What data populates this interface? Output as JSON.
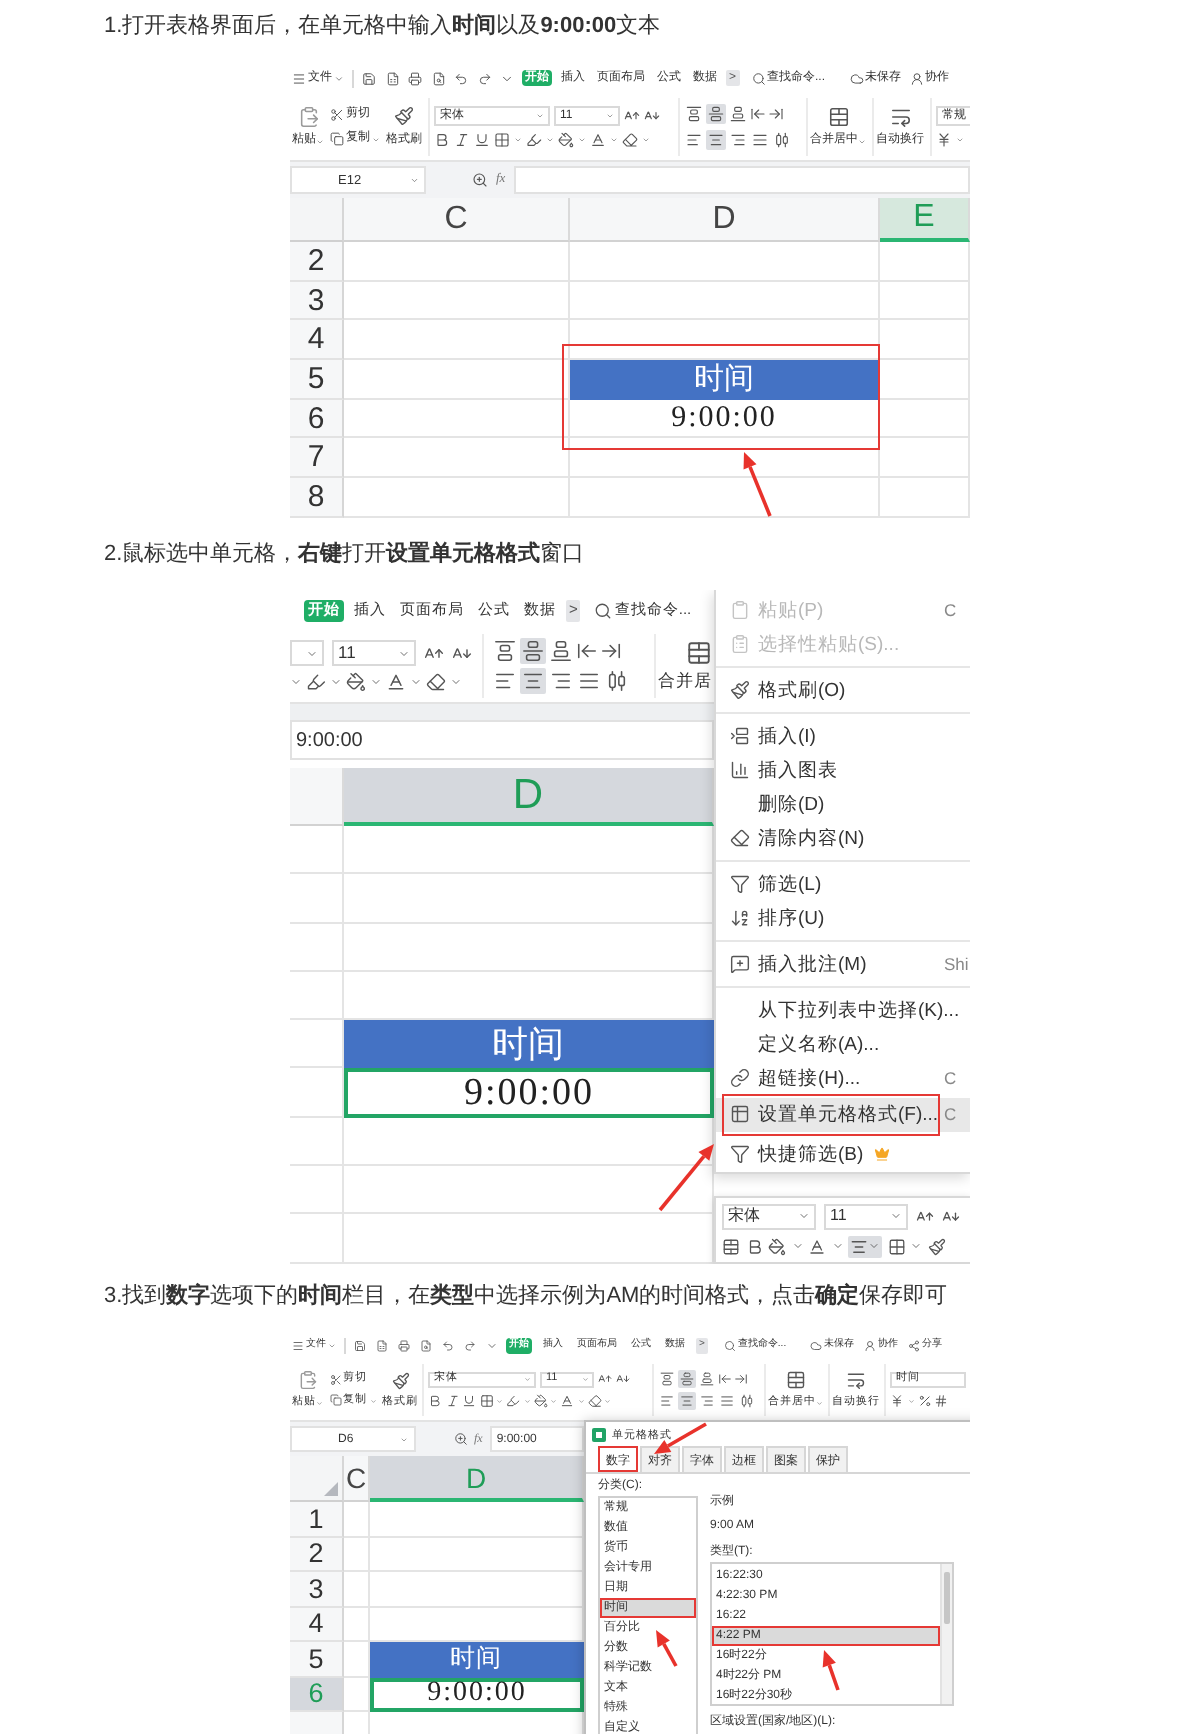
{
  "steps": [
    {
      "instruction": "1.打开表格界面后，在单元格中输入**时间**以及**9:00:00**文本",
      "screenshot": {
        "kind": "sheet",
        "menu_bar": {
          "file": "文件",
          "tabs": [
            {
              "label": "开始",
              "selected": true
            },
            {
              "label": "插入",
              "selected": false
            },
            {
              "label": "页面布局",
              "selected": false
            },
            {
              "label": "公式",
              "selected": false
            },
            {
              "label": "数据",
              "selected": false
            }
          ],
          "more": ">",
          "search": "查找命令...",
          "actions": [
            "未保存",
            "协作"
          ]
        },
        "ribbon": {
          "paste": "粘贴",
          "cut": "剪切",
          "copy": "复制",
          "format_painter": "格式刷",
          "font": "宋体",
          "font_size": "11",
          "vertical_align": [
            {
              "selected": false
            },
            {
              "selected": true
            },
            {
              "selected": false
            }
          ],
          "horizontal_align": [
            {
              "selected": false
            },
            {
              "selected": true
            },
            {
              "selected": false
            },
            {
              "selected": false
            },
            {
              "selected": false
            }
          ],
          "merge": "合并居中",
          "wrap": "自动换行",
          "number_format": "常规"
        },
        "formula_bar": {
          "cell_ref": "E12",
          "fx": "fx"
        },
        "grid": {
          "columns": [
            {
              "label": "C",
              "selected": false
            },
            {
              "label": "D",
              "selected": false
            },
            {
              "label": "E",
              "selected": true
            }
          ],
          "rows": [
            {
              "label": "2",
              "selected": false,
              "cells": [
                {
                  "kind": "empty"
                },
                {
                  "kind": "empty"
                },
                {
                  "kind": "empty"
                }
              ]
            },
            {
              "label": "3",
              "selected": false,
              "cells": [
                {
                  "kind": "empty"
                },
                {
                  "kind": "empty"
                },
                {
                  "kind": "empty"
                }
              ]
            },
            {
              "label": "4",
              "selected": false,
              "cells": [
                {
                  "kind": "empty"
                },
                {
                  "kind": "empty"
                },
                {
                  "kind": "empty"
                }
              ]
            },
            {
              "label": "5",
              "selected": false,
              "cells": [
                {
                  "kind": "empty"
                },
                {
                  "kind": "heading",
                  "text": "时间"
                },
                {
                  "kind": "empty"
                }
              ]
            },
            {
              "label": "6",
              "selected": false,
              "cells": [
                {
                  "kind": "empty"
                },
                {
                  "kind": "value",
                  "text": "9:00:00",
                  "selected": false
                },
                {
                  "kind": "empty"
                }
              ]
            },
            {
              "label": "7",
              "selected": false,
              "cells": [
                {
                  "kind": "empty"
                },
                {
                  "kind": "empty"
                },
                {
                  "kind": "empty"
                }
              ]
            },
            {
              "label": "8",
              "selected": false,
              "cells": [
                {
                  "kind": "empty"
                },
                {
                  "kind": "empty"
                },
                {
                  "kind": "empty"
                }
              ]
            }
          ]
        }
      }
    },
    {
      "instruction": "2.鼠标选中单元格，**右键**打开**设置单元格格式**窗口",
      "screenshot": {
        "kind": "context-menu",
        "menu_bar": {
          "tabs": [
            {
              "label": "开始",
              "selected": true
            },
            {
              "label": "插入",
              "selected": false
            },
            {
              "label": "页面布局",
              "selected": false
            },
            {
              "label": "公式",
              "selected": false
            },
            {
              "label": "数据",
              "selected": false
            }
          ],
          "more": ">",
          "search": "查找命令..."
        },
        "ribbon": {
          "font_size": "11",
          "vertical_align": [
            {
              "selected": false
            },
            {
              "selected": true
            },
            {
              "selected": false
            }
          ],
          "horizontal_align": [
            {
              "selected": false
            },
            {
              "selected": true
            },
            {
              "selected": false
            },
            {
              "selected": false
            },
            {
              "selected": false
            }
          ],
          "merge": "合并居"
        },
        "formula_bar": {
          "value": "9:00:00"
        },
        "grid": {
          "columns": [
            {
              "selected": false
            },
            {
              "label": "D",
              "selected": true
            }
          ],
          "rows": [
            {
              "cells": [
                {
                  "kind": "empty"
                },
                {
                  "kind": "empty"
                }
              ]
            },
            {
              "cells": [
                {
                  "kind": "empty"
                },
                {
                  "kind": "empty"
                }
              ]
            },
            {
              "cells": [
                {
                  "kind": "empty"
                },
                {
                  "kind": "empty"
                }
              ]
            },
            {
              "cells": [
                {
                  "kind": "empty"
                },
                {
                  "kind": "empty"
                }
              ]
            },
            {
              "cells": [
                {
                  "kind": "empty"
                },
                {
                  "kind": "heading",
                  "text": "时间"
                }
              ]
            },
            {
              "cells": [
                {
                  "kind": "empty"
                },
                {
                  "kind": "value",
                  "text": "9:00:00",
                  "selected": true
                }
              ]
            },
            {
              "cells": [
                {
                  "kind": "empty"
                },
                {
                  "kind": "empty"
                }
              ]
            },
            {
              "cells": [
                {
                  "kind": "empty"
                },
                {
                  "kind": "empty"
                }
              ]
            },
            {
              "cells": [
                {
                  "kind": "empty"
                },
                {
                  "kind": "empty"
                }
              ]
            }
          ]
        },
        "context_menu": {
          "items": [
            {
              "kind": "item",
              "label": "粘贴(P)",
              "shortcut": "C",
              "disabled": true,
              "marked": false
            },
            {
              "kind": "item",
              "label": "选择性粘贴(S)...",
              "disabled": true,
              "marked": false
            },
            {
              "kind": "divider"
            },
            {
              "kind": "item",
              "label": "格式刷(O)",
              "disabled": false,
              "marked": false
            },
            {
              "kind": "divider"
            },
            {
              "kind": "item",
              "label": "插入(I)",
              "disabled": false,
              "marked": false
            },
            {
              "kind": "item",
              "label": "插入图表",
              "disabled": false,
              "marked": false
            },
            {
              "kind": "item",
              "label": "删除(D)",
              "disabled": false,
              "marked": false
            },
            {
              "kind": "item",
              "label": "清除内容(N)",
              "disabled": false,
              "marked": false
            },
            {
              "kind": "divider"
            },
            {
              "kind": "item",
              "label": "筛选(L)",
              "disabled": false,
              "marked": false
            },
            {
              "kind": "item",
              "label": "排序(U)",
              "disabled": false,
              "marked": false
            },
            {
              "kind": "divider"
            },
            {
              "kind": "item",
              "label": "插入批注(M)",
              "shortcut": "Shi",
              "disabled": false,
              "marked": false
            },
            {
              "kind": "divider"
            },
            {
              "kind": "item",
              "label": "从下拉列表中选择(K)...",
              "disabled": false,
              "marked": false
            },
            {
              "kind": "item",
              "label": "定义名称(A)...",
              "disabled": false,
              "marked": false
            },
            {
              "kind": "item",
              "label": "超链接(H)...",
              "shortcut": "C",
              "disabled": false,
              "marked": false
            },
            {
              "kind": "item",
              "label": "设置单元格格式(F)...",
              "shortcut": "C",
              "disabled": false,
              "marked": true
            },
            {
              "kind": "item",
              "label": "快捷筛选(B)",
              "disabled": false,
              "marked": false
            }
          ]
        },
        "mini_toolbar": {
          "font": "宋体",
          "font_size": "11",
          "align": {
            "selected": true
          }
        }
      }
    },
    {
      "instruction": "3.找到**数字**选项下的**时间**栏目，在**类型**中选择示例为AM的时间格式，点击**确定**保存即可",
      "screenshot": {
        "kind": "format-dialog",
        "menu_bar": {
          "file": "文件",
          "tabs": [
            {
              "label": "开始",
              "selected": true
            },
            {
              "label": "插入",
              "selected": false
            },
            {
              "label": "页面布局",
              "selected": false
            },
            {
              "label": "公式",
              "selected": false
            },
            {
              "label": "数据",
              "selected": false
            }
          ],
          "more": ">",
          "search": "查找命令...",
          "actions": [
            "未保存",
            "协作",
            "分享"
          ]
        },
        "ribbon": {
          "paste": "粘贴",
          "cut": "剪切",
          "copy": "复制",
          "format_painter": "格式刷",
          "font": "宋体",
          "font_size": "11",
          "vertical_align": [
            {
              "selected": false
            },
            {
              "selected": true
            },
            {
              "selected": false
            }
          ],
          "horizontal_align": [
            {
              "selected": false
            },
            {
              "selected": true
            },
            {
              "selected": false
            },
            {
              "selected": false
            },
            {
              "selected": false
            }
          ],
          "merge": "合并居中",
          "wrap": "自动换行",
          "number_format": "时间"
        },
        "formula_bar": {
          "cell_ref": "D6",
          "fx": "fx",
          "value": "9:00:00"
        },
        "grid": {
          "columns": [
            {
              "label": "C",
              "selected": false
            },
            {
              "label": "D",
              "selected": true
            }
          ],
          "rows": [
            {
              "label": "1",
              "selected": false,
              "cells": [
                {
                  "kind": "empty"
                },
                {
                  "kind": "empty"
                }
              ]
            },
            {
              "label": "2",
              "selected": false,
              "cells": [
                {
                  "kind": "empty"
                },
                {
                  "kind": "empty"
                }
              ]
            },
            {
              "label": "3",
              "selected": false,
              "cells": [
                {
                  "kind": "empty"
                },
                {
                  "kind": "empty"
                }
              ]
            },
            {
              "label": "4",
              "selected": false,
              "cells": [
                {
                  "kind": "empty"
                },
                {
                  "kind": "empty"
                }
              ]
            },
            {
              "label": "5",
              "selected": false,
              "cells": [
                {
                  "kind": "empty"
                },
                {
                  "kind": "heading",
                  "text": "时间"
                }
              ]
            },
            {
              "label": "6",
              "selected": true,
              "cells": [
                {
                  "kind": "empty"
                },
                {
                  "kind": "value",
                  "text": "9:00:00",
                  "selected": true
                }
              ]
            },
            {
              "selected": false,
              "cells": [
                {
                  "kind": "empty"
                },
                {
                  "kind": "empty"
                }
              ]
            }
          ]
        },
        "dialog": {
          "title": "单元格格式",
          "tabs": [
            {
              "label": "数字",
              "selected": true,
              "marked": true
            },
            {
              "label": "对齐",
              "selected": false,
              "marked": false
            },
            {
              "label": "字体",
              "selected": false,
              "marked": false
            },
            {
              "label": "边框",
              "selected": false,
              "marked": false
            },
            {
              "label": "图案",
              "selected": false,
              "marked": false
            },
            {
              "label": "保护",
              "selected": false,
              "marked": false
            }
          ],
          "category_label": "分类(C):",
          "categories": [
            {
              "label": "常规",
              "selected": false,
              "marked": false
            },
            {
              "label": "数值",
              "selected": false,
              "marked": false
            },
            {
              "label": "货币",
              "selected": false,
              "marked": false
            },
            {
              "label": "会计专用",
              "selected": false,
              "marked": false
            },
            {
              "label": "日期",
              "selected": false,
              "marked": false
            },
            {
              "label": "时间",
              "selected": true,
              "marked": true
            },
            {
              "label": "百分比",
              "selected": false,
              "marked": false
            },
            {
              "label": "分数",
              "selected": false,
              "marked": false
            },
            {
              "label": "科学记数",
              "selected": false,
              "marked": false
            },
            {
              "label": "文本",
              "selected": false,
              "marked": false
            },
            {
              "label": "特殊",
              "selected": false,
              "marked": false
            },
            {
              "label": "自定义",
              "selected": false,
              "marked": false
            }
          ],
          "sample_label": "示例",
          "sample": "9:00 AM",
          "type_label": "类型(T):",
          "types": [
            {
              "label": "16:22:30",
              "selected": false,
              "marked": false
            },
            {
              "label": "4:22:30 PM",
              "selected": false,
              "marked": false
            },
            {
              "label": "16:22",
              "selected": false,
              "marked": false
            },
            {
              "label": "4:22 PM",
              "selected": true,
              "marked": true
            },
            {
              "label": "16时22分",
              "selected": false,
              "marked": false
            },
            {
              "label": "4时22分 PM",
              "selected": false,
              "marked": false
            },
            {
              "label": "16时22分30秒",
              "selected": false,
              "marked": false
            }
          ],
          "locale_label": "区域设置(国家/地区)(L):"
        }
      }
    }
  ]
}
